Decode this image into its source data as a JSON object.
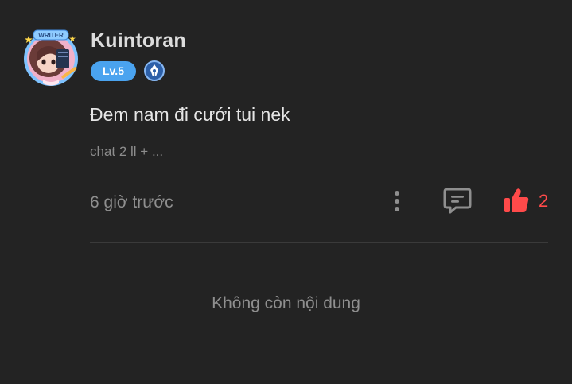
{
  "comment": {
    "author": {
      "name": "Kuintoran",
      "level": "Lv.5",
      "avatar_badge_text": "WRITER",
      "avatar_icon": "avatar-with-writer-frame",
      "role_icon": "pen-nib-icon"
    },
    "text": "Đem nam đi cưới tui nek",
    "quote": "chat 2 ll + ...",
    "timestamp": "6 giờ trước",
    "actions": {
      "more_icon": "more-vertical-icon",
      "reply_icon": "comment-icon",
      "like_icon": "thumbs-up-icon",
      "like_count": "2"
    }
  },
  "empty_state": {
    "message": "Không còn nội dung"
  },
  "colors": {
    "background": "#232323",
    "level_badge": "#4aa3ef",
    "like_active": "#ff4a4a",
    "text_primary": "#e6e6e6",
    "text_muted": "#8f8f8f"
  }
}
